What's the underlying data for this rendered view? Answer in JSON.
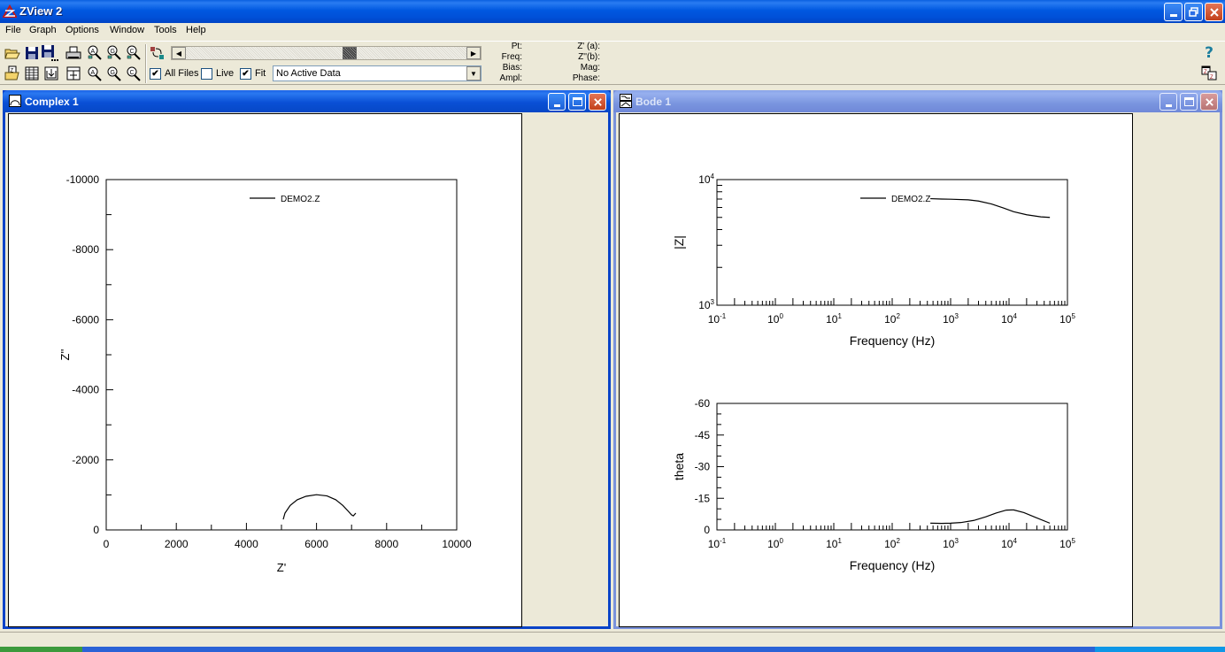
{
  "app": {
    "title": "ZView 2"
  },
  "menu": [
    {
      "label": "File",
      "accel": "F"
    },
    {
      "label": "Graph",
      "accel": "G"
    },
    {
      "label": "Options",
      "accel": "O"
    },
    {
      "label": "Window",
      "accel": "W"
    },
    {
      "label": "Tools",
      "accel": "T"
    },
    {
      "label": "Help",
      "accel": "H"
    }
  ],
  "toolbar": {
    "row1_icons": [
      "open-icon",
      "save-icon",
      "save-as-icon",
      "print-icon",
      "zoom-all-icon",
      "zoom-graph-icon",
      "zoom-complex-icon"
    ],
    "row2_icons": [
      "open-z-file-icon",
      "data-table-icon",
      "import-icon",
      "split-view-icon",
      "zoom-a-icon",
      "zoom-g-icon",
      "zoom-c-icon"
    ],
    "swap_icon": "swap-data-icon",
    "all_files": {
      "label": "All Files",
      "checked": true
    },
    "live": {
      "label": "Live",
      "checked": false
    },
    "fit": {
      "label": "Fit",
      "checked": true
    },
    "data_select": {
      "value": "No Active Data"
    },
    "scroll_position": 0.55,
    "readouts_left": [
      "Pt:",
      "Freq:",
      "Bias:",
      "Ampl:"
    ],
    "readouts_right": [
      "Z' (a):",
      "Z''(b):",
      "Mag:",
      "Phase:"
    ],
    "help_icon": "help-icon",
    "tile_icon": "tile-windows-icon"
  },
  "windows": {
    "complex": {
      "title": "Complex 1",
      "icon": "nyquist-icon"
    },
    "bode": {
      "title": "Bode 1",
      "icon": "bode-icon"
    }
  },
  "chart_data": [
    {
      "type": "line",
      "name": "complex-plot",
      "title": "",
      "xlabel": "Z'",
      "ylabel": "Z''",
      "xlim": [
        0,
        10000
      ],
      "ylim": [
        0,
        -10000
      ],
      "xticks": [
        0,
        2000,
        4000,
        6000,
        8000,
        10000
      ],
      "xtick_labels": [
        "0",
        "2000",
        "4000",
        "6000",
        "8000",
        "10000"
      ],
      "yticks": [
        0,
        -2000,
        -4000,
        -6000,
        -8000,
        -10000
      ],
      "ytick_labels": [
        "0",
        "-2000",
        "-4000",
        "-6000",
        "-8000",
        "-10000"
      ],
      "legend": {
        "position": "top-center",
        "entries": [
          "DEMO2.Z"
        ]
      },
      "series": [
        {
          "name": "DEMO2.Z",
          "x": [
            5050,
            5100,
            5250,
            5450,
            5700,
            6000,
            6300,
            6550,
            6750,
            6900,
            7000,
            7050,
            7120
          ],
          "y": [
            -300,
            -480,
            -700,
            -860,
            -960,
            -1005,
            -970,
            -860,
            -700,
            -540,
            -430,
            -400,
            -480
          ]
        }
      ]
    },
    {
      "type": "line",
      "name": "bode-magnitude",
      "xscale": "log",
      "yscale": "log",
      "xlabel": "Frequency (Hz)",
      "ylabel": "|Z|",
      "xlim": [
        0.1,
        100000
      ],
      "ylim": [
        1000,
        10000
      ],
      "xtick_labels": [
        "10-1",
        "100",
        "101",
        "102",
        "103",
        "104",
        "105"
      ],
      "ytick_labels": [
        "103",
        "104"
      ],
      "legend": {
        "position": "top-center",
        "entries": [
          "DEMO2.Z"
        ]
      },
      "series": [
        {
          "name": "DEMO2.Z",
          "x": [
            450,
            700,
            1000,
            2000,
            3000,
            5000,
            8000,
            12000,
            20000,
            35000,
            50000
          ],
          "y": [
            7050,
            7000,
            6980,
            6900,
            6750,
            6400,
            5950,
            5550,
            5250,
            5050,
            5000
          ]
        }
      ]
    },
    {
      "type": "line",
      "name": "bode-phase",
      "xscale": "log",
      "xlabel": "Frequency (Hz)",
      "ylabel": "theta",
      "xlim": [
        0.1,
        100000
      ],
      "ylim": [
        0,
        -60
      ],
      "yticks": [
        0,
        -15,
        -30,
        -45,
        -60
      ],
      "ytick_labels": [
        "0",
        "-15",
        "-30",
        "-45",
        "-60"
      ],
      "xtick_labels": [
        "10-1",
        "100",
        "101",
        "102",
        "103",
        "104",
        "105"
      ],
      "series": [
        {
          "name": "DEMO2.Z",
          "x": [
            450,
            700,
            1000,
            1500,
            2500,
            4000,
            6000,
            9000,
            12000,
            18000,
            28000,
            50000
          ],
          "y": [
            -3.2,
            -3.1,
            -3.2,
            -3.5,
            -4.5,
            -6.2,
            -8.0,
            -9.4,
            -9.5,
            -8.2,
            -6.0,
            -3.2
          ]
        }
      ]
    }
  ]
}
